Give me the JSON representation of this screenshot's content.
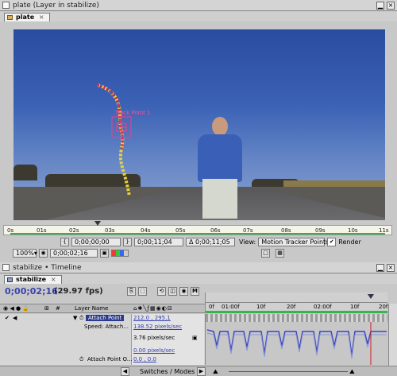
{
  "viewer_window": {
    "title": "plate (Layer in stabilize)",
    "tab": "plate",
    "tracker_label": "Track Point 1",
    "ruler_ticks": [
      "0s",
      "01s",
      "02s",
      "03s",
      "04s",
      "05s",
      "06s",
      "07s",
      "08s",
      "09s",
      "10s",
      "11s"
    ],
    "current_time": "0;00;00;00",
    "out_time": "0;00;11;04",
    "duration": "Δ 0;00;11;05",
    "view_label": "View:",
    "view_select": "Motion Tracker Points",
    "render_label": "Render",
    "zoom": "100%",
    "timecode": "0;00;02;16"
  },
  "timeline_window": {
    "title": "stabilize • Timeline",
    "tab": "stabilize",
    "timecode": "0;00;02;16",
    "fps": "(29.97 fps)",
    "columns": {
      "num": "#",
      "layer_name": "Layer Name"
    },
    "ruler_ticks": [
      "0f",
      "01:00f",
      "10f",
      "20f",
      "02:00f",
      "10f",
      "20f"
    ],
    "rows": [
      {
        "name": "Attach Point",
        "value": "212.0 , 295.1"
      },
      {
        "name": "Speed: Attach...",
        "value": "138.52 pixels/sec"
      },
      {
        "name": "",
        "value": "3.76 pixels/sec"
      },
      {
        "name": "",
        "value": "0.00 pixels/sec"
      },
      {
        "name": "Attach Point O...",
        "value": "0.0 , 0.0"
      }
    ],
    "switches_label": "Switches / Modes"
  }
}
